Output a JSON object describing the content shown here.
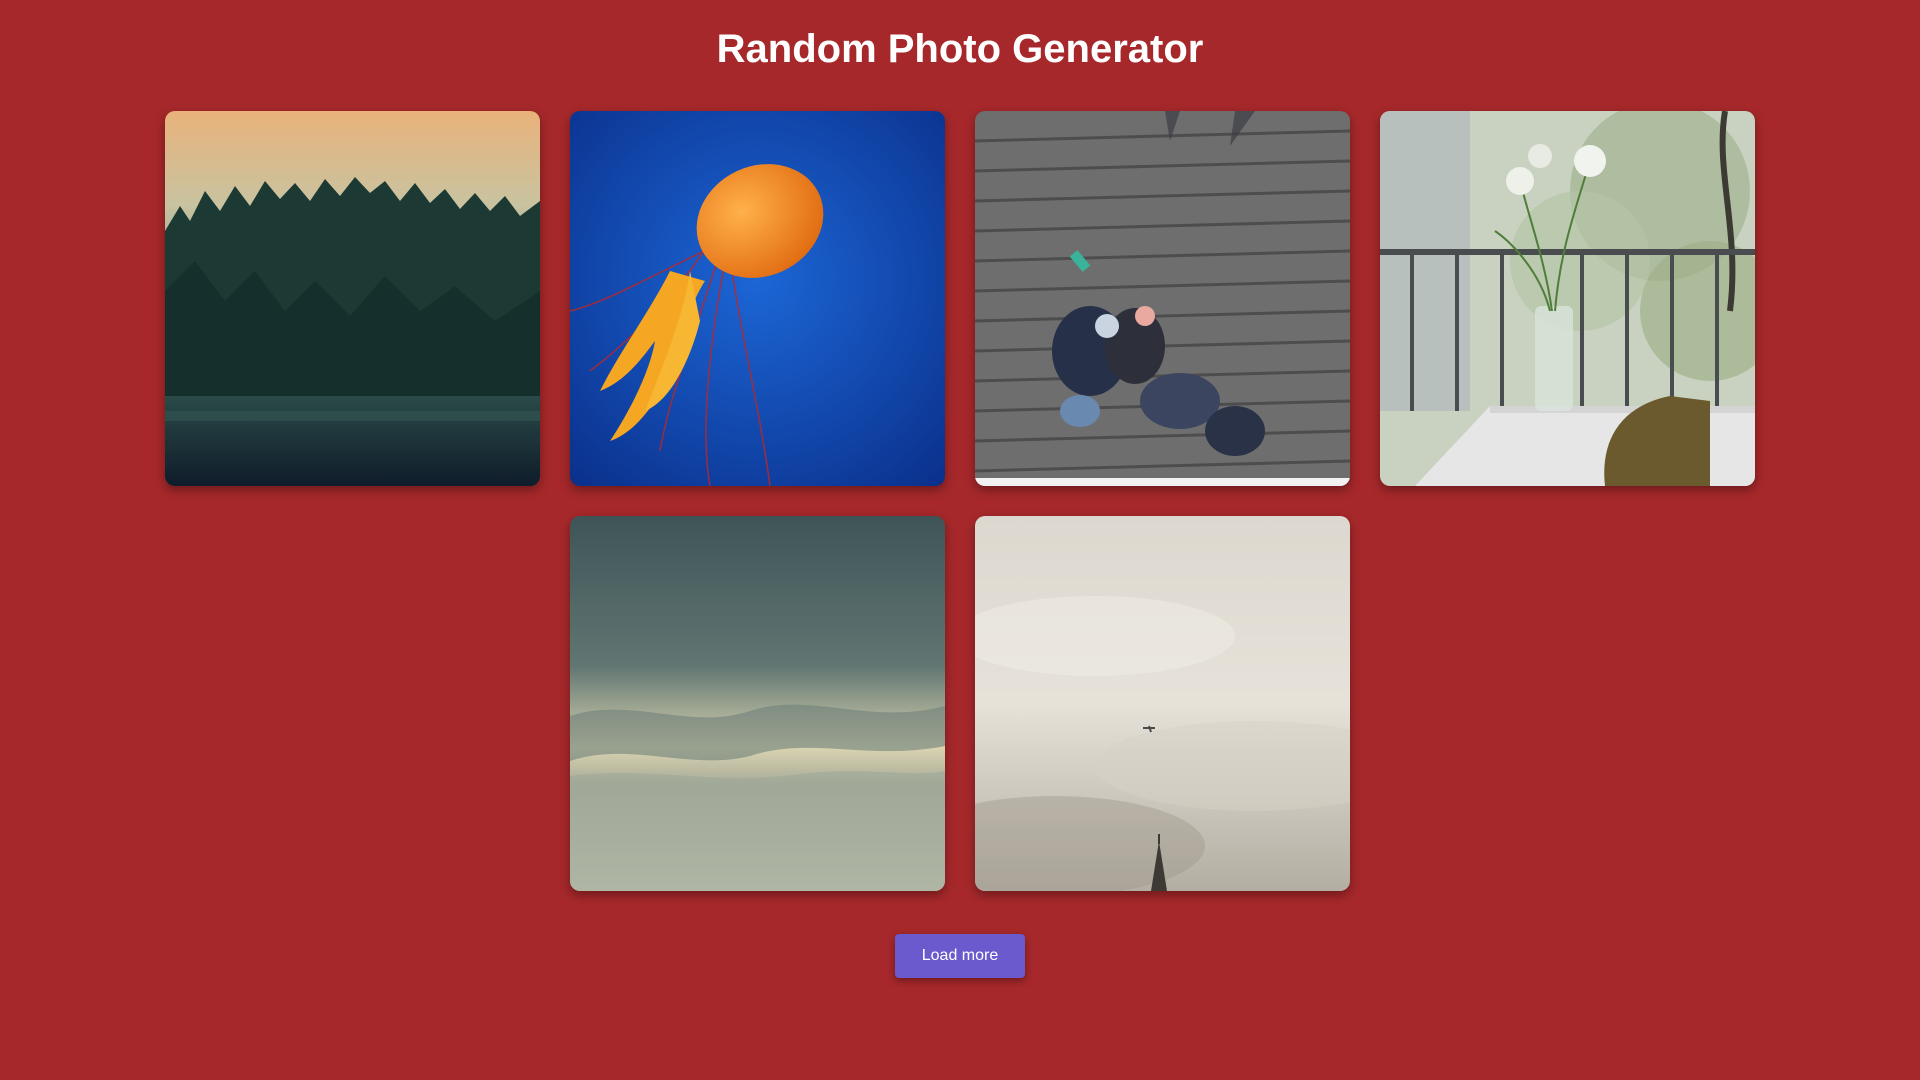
{
  "header": {
    "title": "Random Photo Generator"
  },
  "photos": [
    {
      "subject": "forest-at-dusk"
    },
    {
      "subject": "orange-jellyfish"
    },
    {
      "subject": "people-on-boardwalk"
    },
    {
      "subject": "flowers-in-vase-on-balcony"
    },
    {
      "subject": "stormy-sky"
    },
    {
      "subject": "overcast-sky-with-plane-and-spire"
    }
  ],
  "actions": {
    "load_more_label": "Load more"
  },
  "colors": {
    "background": "#a6282a",
    "button": "#6a5acd",
    "title": "#ffffff"
  }
}
